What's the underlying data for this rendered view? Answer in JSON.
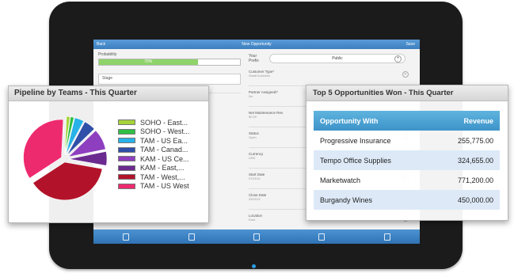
{
  "app": {
    "back_label": "Back",
    "title": "New Opportunity",
    "save_label": "Save"
  },
  "form": {
    "probability_label": "Probability",
    "probability_value": "70%",
    "probability_fraction": 0.7,
    "stage_label": "Stage",
    "pill_prefix": "Your Prefix",
    "pill_value": "Public",
    "fields": [
      {
        "label": "Customer Type*",
        "value": "Small business"
      },
      {
        "label": "Partner Assigned?",
        "value": "No"
      },
      {
        "label": "Net Maintenance Rev",
        "value": "$0.00"
      },
      {
        "label": "Status",
        "value": "Open"
      },
      {
        "label": "Currency",
        "value": "USD"
      },
      {
        "label": "Start Date",
        "value": "07/2013"
      },
      {
        "label": "Close Date",
        "value": "09/2013"
      },
      {
        "label": "Location",
        "value": "East"
      }
    ]
  },
  "pipeline": {
    "title": "Pipeline by Teams - This Quarter",
    "legend": [
      {
        "label": "SOHO - East...",
        "color": "#a6d33b"
      },
      {
        "label": "SOHO - West...",
        "color": "#2fbf44"
      },
      {
        "label": "TAM - US Ea...",
        "color": "#28b2e8"
      },
      {
        "label": "TAM - Canad...",
        "color": "#2f4fa8"
      },
      {
        "label": "KAM - US Ce...",
        "color": "#8e3fbf"
      },
      {
        "label": "KAM - East,...",
        "color": "#6b2a8f"
      },
      {
        "label": "TAM - West,...",
        "color": "#b3132a"
      },
      {
        "label": "TAM - US West",
        "color": "#ee2a6f"
      }
    ]
  },
  "chart_data": {
    "type": "pie",
    "title": "Pipeline by Teams - This Quarter",
    "categories": [
      "SOHO - East...",
      "SOHO - West...",
      "TAM - US Ea...",
      "TAM - Canad...",
      "KAM - US Ce...",
      "KAM - East,...",
      "TAM - West,...",
      "TAM - US West"
    ],
    "values": [
      1.5,
      1.5,
      4,
      5,
      9,
      6,
      38,
      35
    ],
    "colors": [
      "#a6d33b",
      "#2fbf44",
      "#28b2e8",
      "#2f4fa8",
      "#8e3fbf",
      "#6b2a8f",
      "#b3132a",
      "#ee2a6f"
    ]
  },
  "top_opportunities": {
    "title": "Top 5 Opportunities Won - This Quarter",
    "col_opportunity": "Opportunity With",
    "col_revenue": "Revenue",
    "rows": [
      {
        "name": "Progressive Insurance",
        "revenue": "255,775.00"
      },
      {
        "name": "Tempo Office Supplies",
        "revenue": "324,655.00"
      },
      {
        "name": "Marketwatch",
        "revenue": "771,200.00"
      },
      {
        "name": "Burgandy Wines",
        "revenue": "450,000.00"
      }
    ]
  }
}
